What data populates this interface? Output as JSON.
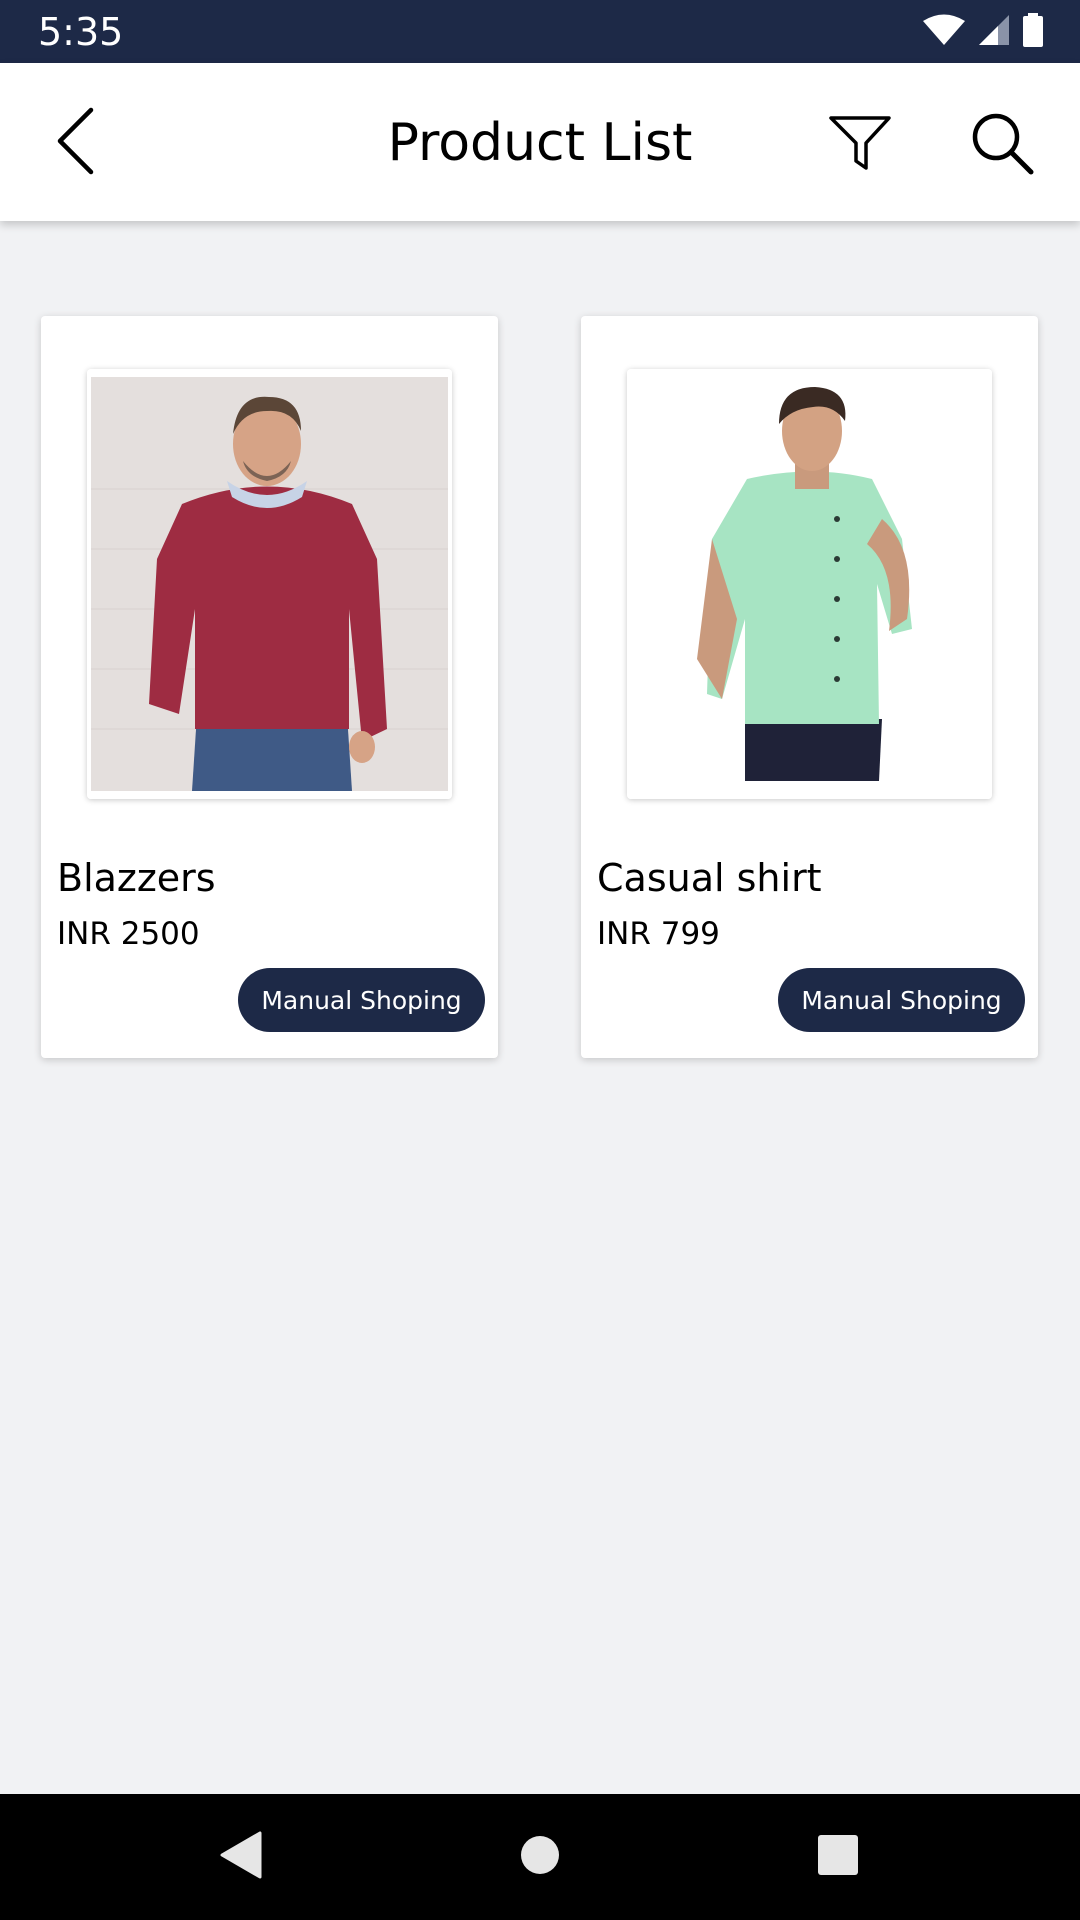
{
  "status_bar": {
    "time": "5:35",
    "icons": [
      "wifi-icon",
      "signal-icon",
      "battery-icon"
    ],
    "background": "#1d2947"
  },
  "app_bar": {
    "title": "Product List",
    "back_icon": "chevron-left-icon",
    "filter_icon": "filter-icon",
    "search_icon": "search-icon"
  },
  "products": [
    {
      "name": "Blazzers",
      "price": "INR 2500",
      "button_label": "Manual Shoping",
      "image": "man-in-red-sweater-photo"
    },
    {
      "name": "Casual shirt",
      "price": "INR 799",
      "button_label": "Manual Shoping",
      "image": "man-in-mint-shirt-photo"
    }
  ],
  "nav_bar": {
    "icons": [
      "nav-back-icon",
      "nav-home-icon",
      "nav-recents-icon"
    ]
  },
  "colors": {
    "accent": "#1d2947",
    "background": "#f1f2f4",
    "card": "#ffffff"
  }
}
